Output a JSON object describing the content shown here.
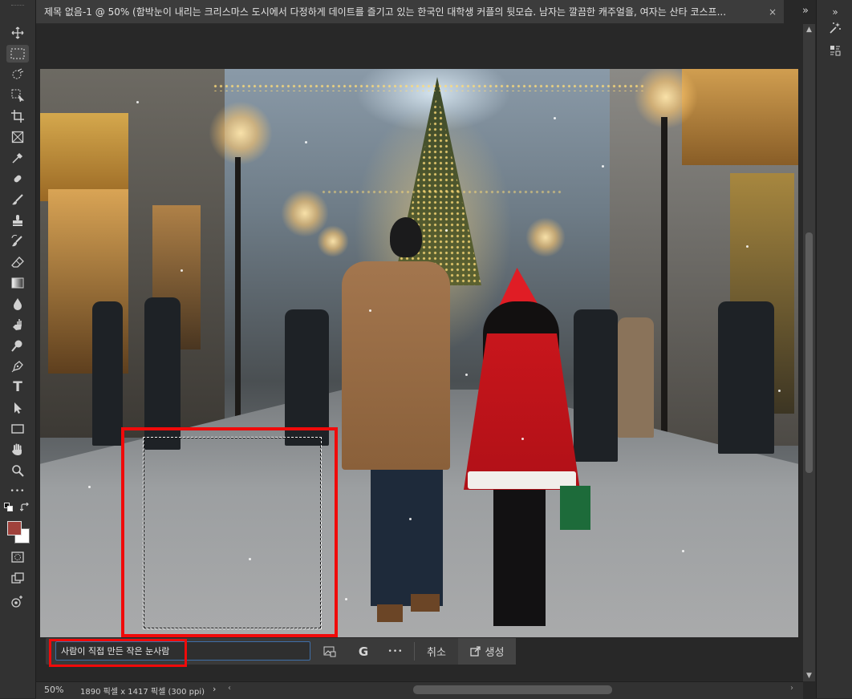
{
  "app": {
    "document_tab_title": "제목 없음-1 @ 50% (함박눈이 내리는 크리스마스 도시에서 다정하게 데이트를 즐기고 있는 한국인 대학생 커플의 뒷모습. 남자는 깔끔한 캐주얼을, 여자는 산타 코스프...",
    "close_glyph": "×",
    "panel_expand_glyph": "»"
  },
  "toolbar": {
    "icons": [
      "move-icon",
      "rect-marquee-icon",
      "object-select-icon",
      "crop-icon",
      "frame-icon",
      "eyedropper-icon",
      "spot-healing-icon",
      "brush-icon",
      "clone-stamp-icon",
      "history-brush-icon",
      "eraser-icon",
      "gradient-icon",
      "blur-icon",
      "smudge-icon",
      "dodge-icon",
      "pen-icon",
      "type-icon",
      "path-select-icon",
      "rectangle-icon",
      "hand-icon",
      "zoom-icon",
      "more-tools-icon"
    ],
    "type_glyph": "T",
    "more_glyph": "•••",
    "foreground_color": "#a0423c",
    "background_color": "#ffffff"
  },
  "contextual_taskbar": {
    "prompt_value": "사람이 직접 만든 작은 눈사람",
    "cancel_label": "취소",
    "generate_label": "생성",
    "more_glyph": "•••",
    "google_glyph": "G"
  },
  "status_bar": {
    "zoom": "50%",
    "doc_info": "1890 픽셀 x 1417 픽셀 (300 ppi)",
    "arrow": "›",
    "left_arrow": "‹",
    "right_arrow": "›"
  },
  "right_panel": {
    "icons": [
      "adjust-icon",
      "properties-icon"
    ]
  },
  "colors": {
    "annotation_red": "#f00a0a",
    "input_border": "#3f6fa8"
  }
}
